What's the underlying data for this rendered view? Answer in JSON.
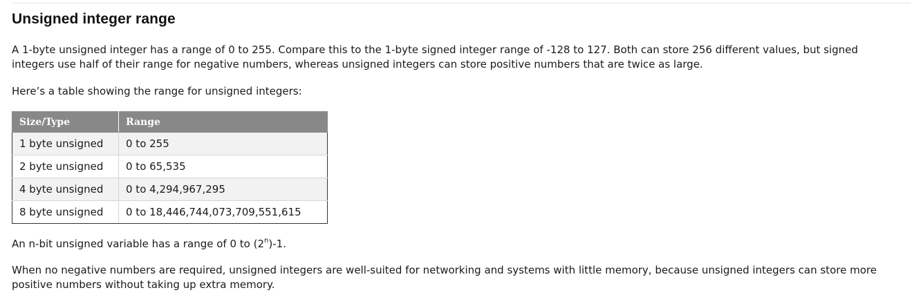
{
  "heading": "Unsigned integer range",
  "paragraph1": "A 1-byte unsigned integer has a range of 0 to 255. Compare this to the 1-byte signed integer range of -128 to 127. Both can store 256 different values, but signed integers use half of their range for negative numbers, whereas unsigned integers can store positive numbers that are twice as large.",
  "paragraph2": "Here’s a table showing the range for unsigned integers:",
  "table": {
    "headers": [
      "Size/Type",
      "Range"
    ],
    "rows": [
      [
        "1 byte unsigned",
        "0 to 255"
      ],
      [
        "2 byte unsigned",
        "0 to 65,535"
      ],
      [
        "4 byte unsigned",
        "0 to 4,294,967,295"
      ],
      [
        "8 byte unsigned",
        "0 to 18,446,744,073,709,551,615"
      ]
    ]
  },
  "formula": {
    "prefix": "An n-bit unsigned variable has a range of 0 to (2",
    "exponent": "n",
    "suffix": ")-1."
  },
  "paragraph4": "When no negative numbers are required, unsigned integers are well-suited for networking and systems with little memory, because unsigned integers can store more positive numbers without taking up extra memory.",
  "colors": {
    "header_bg": "#888888",
    "row_alt_bg": "#f2f2f2",
    "text": "#1a1a1a"
  }
}
